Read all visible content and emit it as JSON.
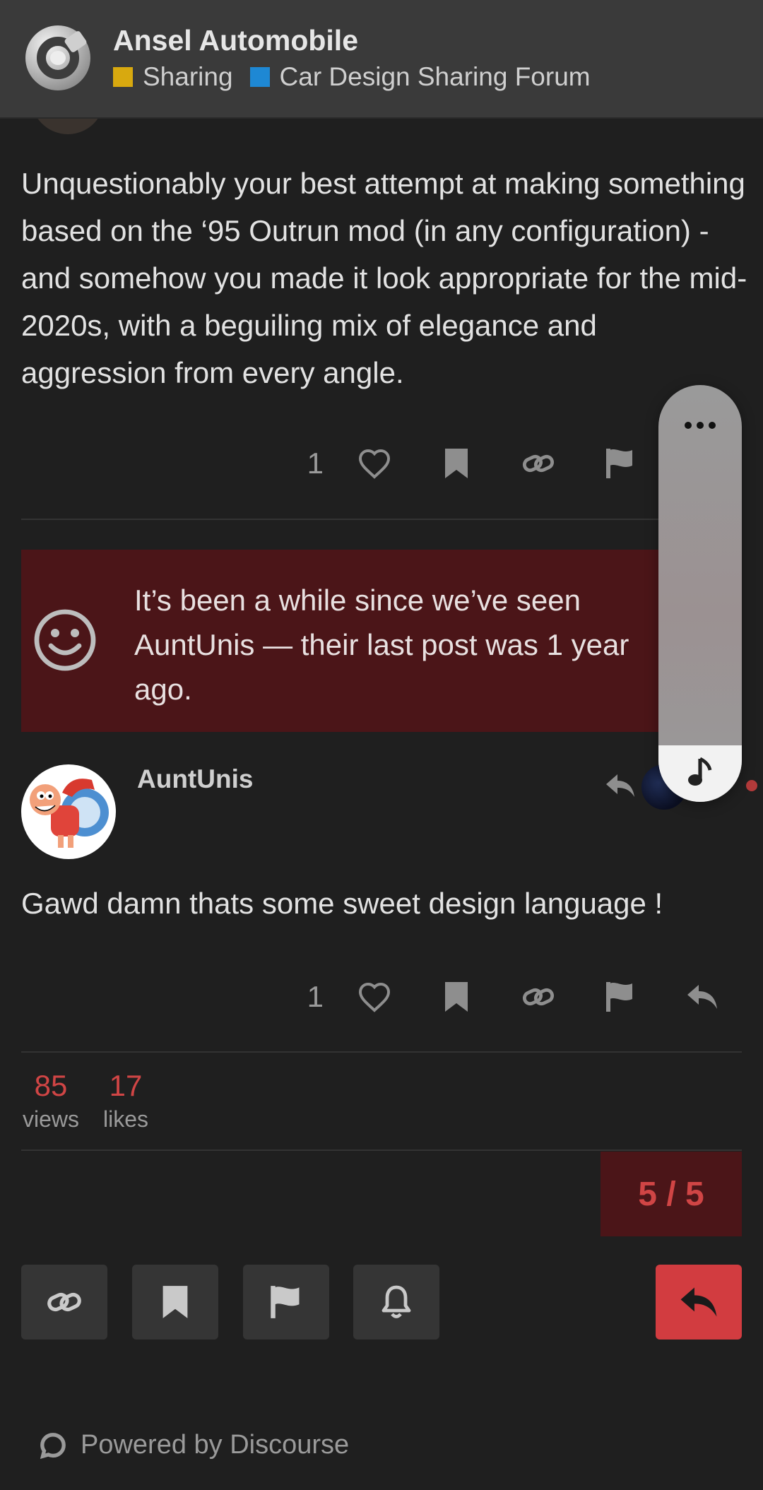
{
  "header": {
    "site_title": "Ansel Automobile",
    "breadcrumbs": [
      {
        "label": "Sharing",
        "color": "#d8a90f"
      },
      {
        "label": "Car Design Sharing Forum",
        "color": "#1e88d4"
      }
    ]
  },
  "posts": [
    {
      "text": "Unquestionably your best attempt at making something based on the ‘95 Outrun mod (in any configuration) - and somehow you made it look appropriate for the mid-2020s, with a beguiling mix of elegance and aggression from every angle.",
      "like_count": "1"
    },
    {
      "author": "AuntUnis",
      "text": "Gawd damn thats some sweet design language !",
      "like_count": "1"
    }
  ],
  "notice": {
    "text": "It’s been a while since we’ve seen AuntUnis — their last post was 1 year ago."
  },
  "stats": [
    {
      "value": "85",
      "label": "views"
    },
    {
      "value": "17",
      "label": "likes"
    }
  ],
  "progress": "5 / 5",
  "footer": {
    "powered_by": "Powered by Discourse"
  },
  "colors": {
    "accent": "#d23c40",
    "notice_bg": "#4b1518",
    "header_bg": "#3a3a3a"
  }
}
